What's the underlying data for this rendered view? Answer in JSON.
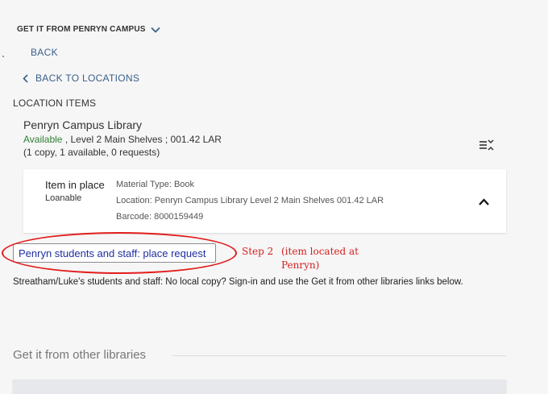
{
  "header": {
    "title": "GET IT FROM PENRYN CAMPUS",
    "icon": "chevron-down-icon"
  },
  "nav": {
    "back_label": "BACK",
    "back_to_locations_label": "BACK TO LOCATIONS"
  },
  "location_items": {
    "section_label": "LOCATION ITEMS",
    "library": {
      "name": "Penryn Campus Library",
      "availability": "Available",
      "shelf_info": " , Level 2 Main Shelves ; 001.42 LAR",
      "copies": "(1 copy, 1 available, 0 requests)"
    },
    "item": {
      "status": "Item in place",
      "policy": "Loanable",
      "material_type": "Material Type: Book",
      "location": "Location: Penryn Campus Library Level 2 Main Shelves 001.42 LAR",
      "barcode": "Barcode: 8000159449"
    }
  },
  "request": {
    "button_label": "Penryn students and staff: place request",
    "annotation_step": "Step 2",
    "annotation_line1": "(item located at",
    "annotation_line2": "Penryn)"
  },
  "notice": {
    "text": "Streatham/Luke's students and staff: No local copy? Sign-in and use the Get it from other libraries links below."
  },
  "other_libraries": {
    "title": "Get it from other libraries"
  },
  "colors": {
    "link": "#3a5f8a",
    "available": "#2f7d32",
    "request_text": "#1f2fa3",
    "annotation": "#e21d1d"
  }
}
